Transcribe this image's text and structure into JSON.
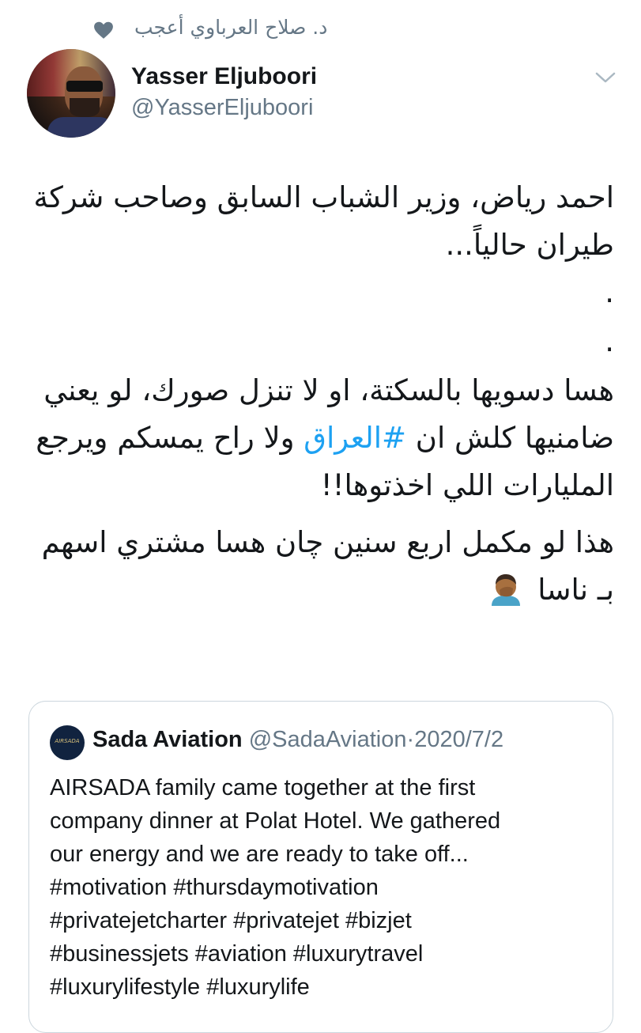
{
  "social_context": {
    "text": "د. صلاح العرباوي أعجب"
  },
  "author": {
    "name": "Yasser Eljuboori",
    "handle": "@YasserEljuboori"
  },
  "tweet": {
    "paragraph_1": "احمد رياض، وزير الشباب السابق وصاحب شركة طيران حالياً...",
    "dot_1": ".",
    "dot_2": ".",
    "paragraph_3_before": "هسا دسويها بالسكتة، او لا تنزل صورك، لو يعني ضامنيها كلش ان ",
    "hashtag": "#العراق",
    "paragraph_3_after": " ولا راح يمسكم ويرجع المليارات اللي اخذتوها!!",
    "paragraph_4": "هذا لو مكمل اربع سنين چان هسا مشتري اسهم بـ ناسا"
  },
  "quoted_tweet": {
    "avatar_text": "AIRSADA",
    "name": "Sada Aviation",
    "handle": "@SadaAviation",
    "separator": "·",
    "date": "2020/7/2",
    "lines": [
      "AIRSADA family came together at the first",
      "company dinner at Polat Hotel. We gathered",
      "our energy and we are ready to take off...",
      "#motivation #thursdaymotivation",
      "#privatejetcharter #privatejet #bizjet",
      "#businessjets #aviation #luxurytravel",
      "#luxurylifestyle #luxurylife"
    ]
  },
  "colors": {
    "link": "#1da1f2",
    "secondary": "#657786",
    "border": "#ccd6dd"
  },
  "icons": {
    "like": "heart-icon",
    "menu": "chevron-down-icon",
    "emoji": "facepalm-icon"
  }
}
